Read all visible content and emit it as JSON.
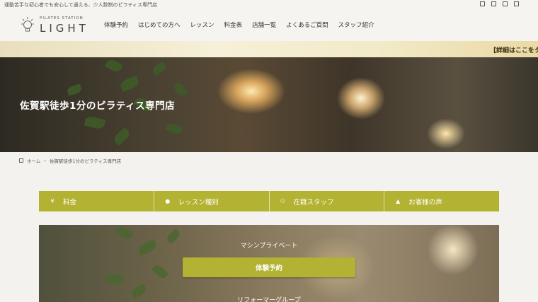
{
  "header": {
    "tagline": "運動苦手な初心者でも安心して通える、少人数制のピラティス専門店",
    "logo_sub": "PILATES STATION",
    "logo_main": "LIGHT",
    "nav": [
      "体験予約",
      "はじめての方へ",
      "レッスン",
      "料金表",
      "店舗一覧",
      "よくあるご質問",
      "スタッフ紹介"
    ]
  },
  "banner": {
    "text": "【詳細はここをタ"
  },
  "hero": {
    "title": "佐賀駅徒歩1分のピラティス専門店"
  },
  "breadcrumb": {
    "home": "ホーム",
    "current": "佐賀駅徒歩1分のピラティス専門店"
  },
  "tabs": [
    {
      "label": "料金",
      "icon": "yen-icon"
    },
    {
      "label": "レッスン種別",
      "icon": "lightbulb-icon"
    },
    {
      "label": "在籍スタッフ",
      "icon": "users-icon"
    },
    {
      "label": "お客様の声",
      "icon": "thumbs-up-icon"
    }
  ],
  "lower": {
    "title1": "マシンプライベート",
    "cta": "体験予約",
    "title2": "リフォーマーグループ"
  },
  "colors": {
    "accent": "#b3b232",
    "banner": "#f2eac8"
  }
}
